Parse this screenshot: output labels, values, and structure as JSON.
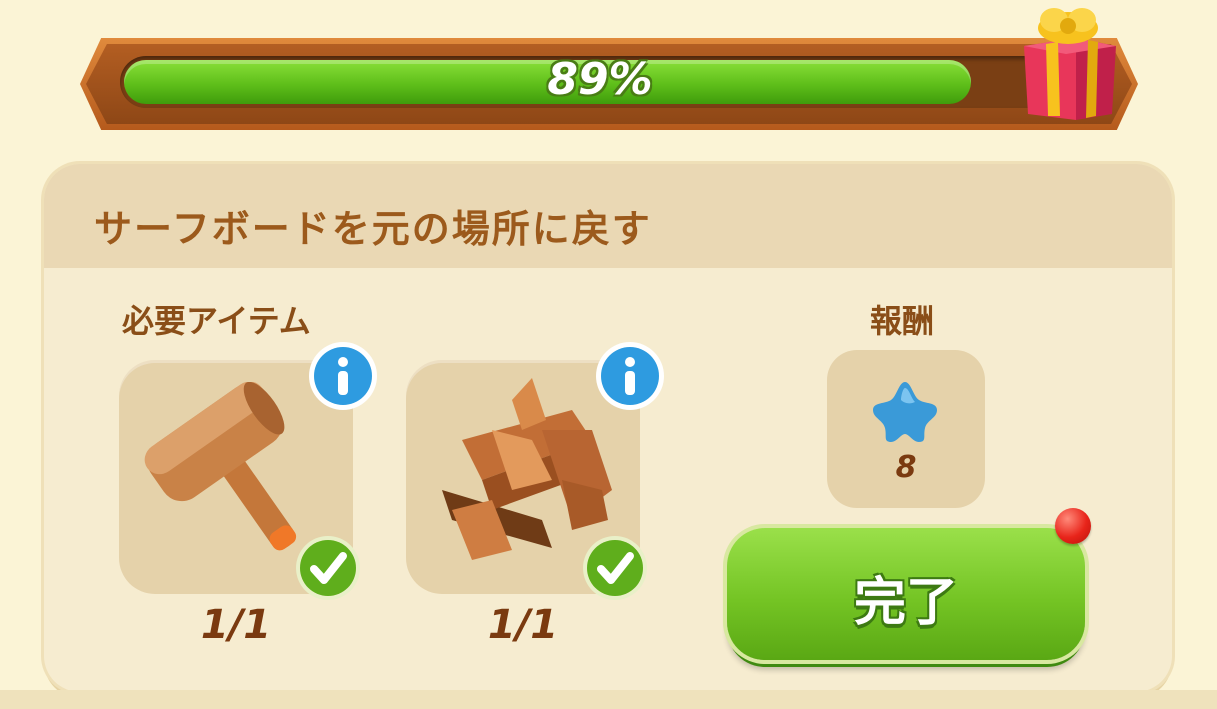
{
  "progress": {
    "value": 0.89,
    "label": "89%"
  },
  "task": {
    "title": "サーフボードを元の場所に戻す"
  },
  "required": {
    "label": "必要アイテム",
    "items": [
      {
        "icon": "mallet-icon",
        "count": "1/1",
        "complete": true
      },
      {
        "icon": "firewood-icon",
        "count": "1/1",
        "complete": true
      }
    ]
  },
  "reward": {
    "label": "報酬",
    "icon": "blue-star-icon",
    "amount": "8"
  },
  "complete_button": {
    "label": "完了"
  },
  "colors": {
    "accent_green": "#6cbf22",
    "title_brown": "#9c5a1c",
    "panel": "#f6ecd0"
  }
}
